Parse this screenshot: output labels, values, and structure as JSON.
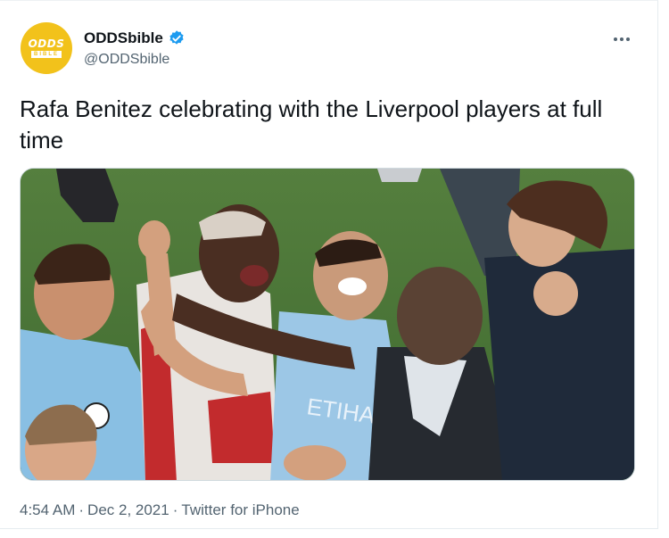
{
  "author": {
    "display_name": "ODDSbible",
    "handle": "@ODDSbible",
    "verified": true,
    "avatar_text_top": "ODDS",
    "avatar_text_bottom": "BIBLE",
    "avatar_color": "#f2c21b"
  },
  "tweet": {
    "text": "Rafa Benitez celebrating with the Liverpool players at full time",
    "time": "4:54 AM",
    "separator": "·",
    "date": "Dec 2, 2021",
    "source": "Twitter for iPhone",
    "shirt_text": "ETIHA"
  },
  "icons": {
    "verified": "verified-badge-icon",
    "more": "more-options-icon",
    "badge_color": "#1d9bf0"
  }
}
